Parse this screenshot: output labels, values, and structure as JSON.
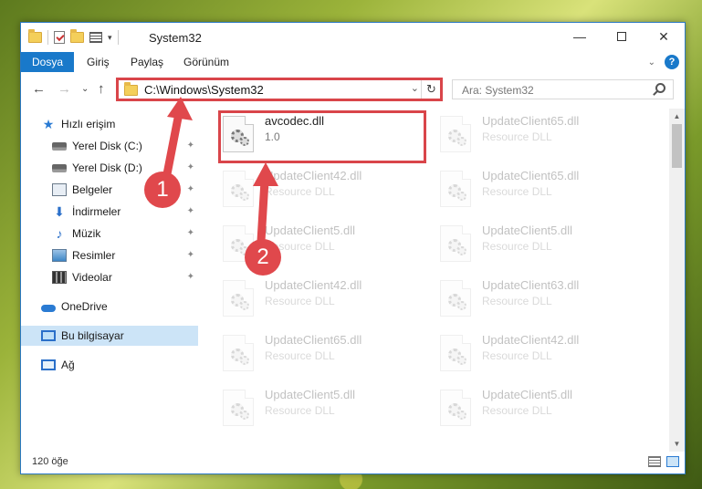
{
  "window": {
    "title": "System32"
  },
  "ribbon": {
    "tabs": [
      "Dosya",
      "Giriş",
      "Paylaş",
      "Görünüm"
    ]
  },
  "address": {
    "path": "C:\\Windows\\System32"
  },
  "search": {
    "placeholder": "Ara: System32"
  },
  "sidebar": {
    "items": [
      {
        "label": "Hızlı erişim",
        "icon": "star-icon"
      },
      {
        "label": "Yerel Disk (C:)",
        "icon": "drive-icon",
        "pinned": true
      },
      {
        "label": "Yerel Disk (D:)",
        "icon": "drive-icon",
        "pinned": true
      },
      {
        "label": "Belgeler",
        "icon": "documents-icon",
        "pinned": true
      },
      {
        "label": "İndirmeler",
        "icon": "download-icon",
        "pinned": true
      },
      {
        "label": "Müzik",
        "icon": "music-icon",
        "pinned": true
      },
      {
        "label": "Resimler",
        "icon": "pictures-icon",
        "pinned": true
      },
      {
        "label": "Videolar",
        "icon": "videos-icon",
        "pinned": true
      },
      {
        "label": "OneDrive",
        "icon": "cloud-icon"
      },
      {
        "label": "Bu bilgisayar",
        "icon": "computer-icon",
        "selected": true
      },
      {
        "label": "Ağ",
        "icon": "network-icon"
      }
    ]
  },
  "files": [
    {
      "name": "avcodec.dll",
      "desc": "1.0",
      "highlight": true
    },
    {
      "name": "UpdateClient65.dll",
      "desc": "Resource DLL"
    },
    {
      "name": "UpdateClient42.dll",
      "desc": "Resource DLL"
    },
    {
      "name": "UpdateClient65.dll",
      "desc": "Resource DLL"
    },
    {
      "name": "UpdateClient5.dll",
      "desc": "Resource DLL"
    },
    {
      "name": "UpdateClient5.dll",
      "desc": "Resource DLL"
    },
    {
      "name": "UpdateClient42.dll",
      "desc": "Resource DLL"
    },
    {
      "name": "UpdateClient63.dll",
      "desc": "Resource DLL"
    },
    {
      "name": "UpdateClient65.dll",
      "desc": "Resource DLL"
    },
    {
      "name": "UpdateClient42.dll",
      "desc": "Resource DLL"
    },
    {
      "name": "UpdateClient5.dll",
      "desc": "Resource DLL"
    },
    {
      "name": "UpdateClient5.dll",
      "desc": "Resource DLL"
    }
  ],
  "status": {
    "count": "120 öğe"
  },
  "annotations": {
    "step1": "1",
    "step2": "2",
    "color": "#e0484c"
  }
}
